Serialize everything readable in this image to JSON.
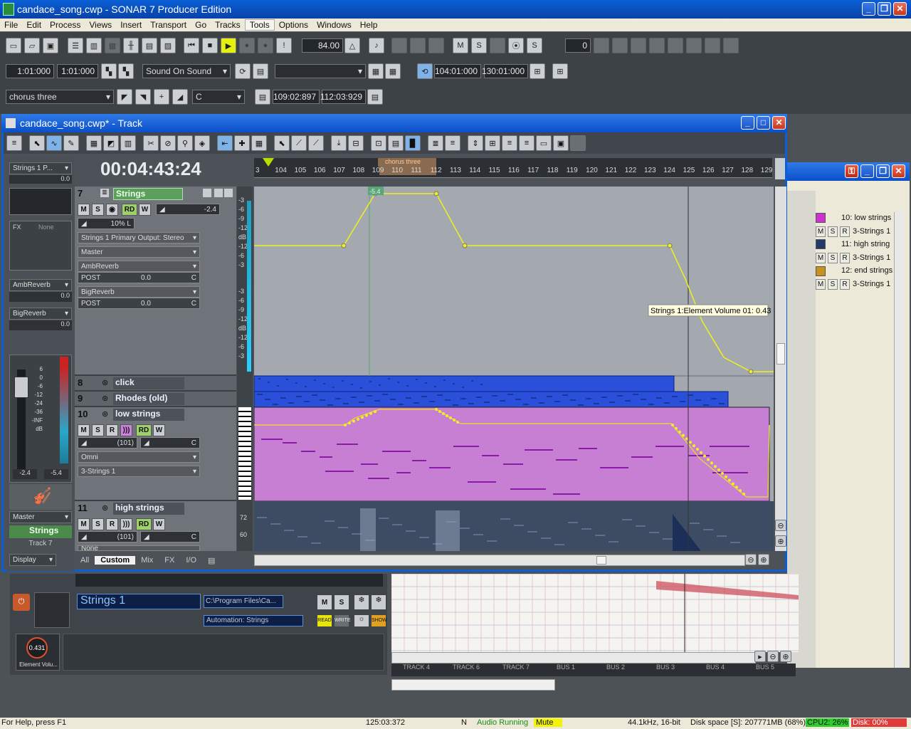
{
  "app": {
    "title": "candace_song.cwp - SONAR 7 Producer Edition",
    "brand_color": "#0a5fd6"
  },
  "menu": [
    "File",
    "Edit",
    "Process",
    "Views",
    "Insert",
    "Transport",
    "Go",
    "Tracks",
    "Tools",
    "Options",
    "Windows",
    "Help"
  ],
  "toolbar": {
    "tempo": "84.00",
    "counter": "0",
    "now": "1:01:000",
    "now2": "1:01:000",
    "sound_on_sound": "Sound On Sound",
    "loop_start": "104:01:000",
    "loop_end": "130:01:000",
    "marker": "chorus three",
    "key": "C",
    "punch_start": "109:02:897",
    "punch_end": "112:03:929"
  },
  "track_window": {
    "title": "candace_song.cwp* - Track",
    "clock": "00:04:43:24",
    "ruler_ticks": [
      "3",
      "104",
      "105",
      "106",
      "107",
      "108",
      "109",
      "110",
      "111",
      "112",
      "113",
      "114",
      "115",
      "116",
      "117",
      "118",
      "119",
      "120",
      "121",
      "122",
      "123",
      "124",
      "125",
      "126",
      "127",
      "128",
      "129"
    ],
    "marker_label": "chorus three",
    "automation_tooltip": "Strings 1:Element Volume 01: 0.43",
    "automation_value_flag": "-5.4",
    "tabs": [
      "All",
      "Custom",
      "Mix",
      "FX",
      "I/O"
    ]
  },
  "inspector": {
    "track": "Strings 1 P...",
    "vol": "0.0",
    "fx_none": "None",
    "fx_label": "FX",
    "send1": "AmbReverb",
    "send1_val": "0.0",
    "send2": "BigReverb",
    "send2_val": "0.0",
    "scale": [
      "6",
      "0",
      "-6",
      "-12",
      "-24",
      "-36",
      "-INF"
    ],
    "db": "dB",
    "peak_l": "-2.4",
    "peak_r": "-5.4",
    "out": "Master",
    "name": "Strings",
    "track_no": "Track 7",
    "display": "Display"
  },
  "tracks": [
    {
      "num": "7",
      "name": "Strings",
      "vol": "-2.4",
      "pan": "10% L",
      "output": "Strings 1 Primary Output: Stereo",
      "bus": "Master",
      "send1": "AmbReverb",
      "send2": "BigReverb",
      "post": "POST",
      "send_val": "0.0",
      "c": "C"
    },
    {
      "num": "8",
      "name": "click"
    },
    {
      "num": "9",
      "name": "Rhodes (old)"
    },
    {
      "num": "10",
      "name": "low strings",
      "vol": "(101)",
      "input": "Omni",
      "out": "3-Strings 1",
      "c": "C"
    },
    {
      "num": "11",
      "name": "high strings",
      "vol": "(101)",
      "c": "C",
      "input": "None"
    }
  ],
  "msr": {
    "m": "M",
    "s": "S",
    "r": "R",
    "rd": "RD",
    "w": "W"
  },
  "vscale": [
    "-3",
    "-6",
    "-9",
    "-12",
    "dB",
    "-12",
    "-6",
    "-3",
    "-3",
    "-6",
    "-9",
    "-12",
    "dB",
    "-12",
    "-6",
    "-3"
  ],
  "note_scale": [
    "72",
    "60"
  ],
  "right_panel": {
    "tracks": [
      {
        "label": "10: low strings",
        "color": "#cc33cc",
        "out": "3-Strings 1"
      },
      {
        "label": "11: high string",
        "color": "#223a6a",
        "out": "3-Strings 1"
      },
      {
        "label": "12: end strings",
        "color": "#c8901c",
        "out": "3-Strings 1"
      }
    ]
  },
  "synth_rack": {
    "name": "Strings 1",
    "path": "C:\\Program Files\\Ca...",
    "automation": "Automation: Strings",
    "read": "READ",
    "write": "WRITE",
    "show": "SHOW",
    "knob_val": "0.431",
    "knob_label": "Element Volu..."
  },
  "bus_strip": [
    "TRACK 4",
    "TRACK 6",
    "TRACK 7",
    "BUS 1",
    "BUS 2",
    "BUS 3",
    "BUS 4",
    "BUS 5"
  ],
  "status": {
    "help": "For Help, press F1",
    "time": "125:03:372",
    "n": "N",
    "audio": "Audio Running",
    "mute": "Mute",
    "format": "44.1kHz, 16-bit",
    "disk": "Disk space [S]: 207771MB (68%)",
    "cpu": "CPU2: 26%",
    "disk_load": "Disk: 00%"
  }
}
